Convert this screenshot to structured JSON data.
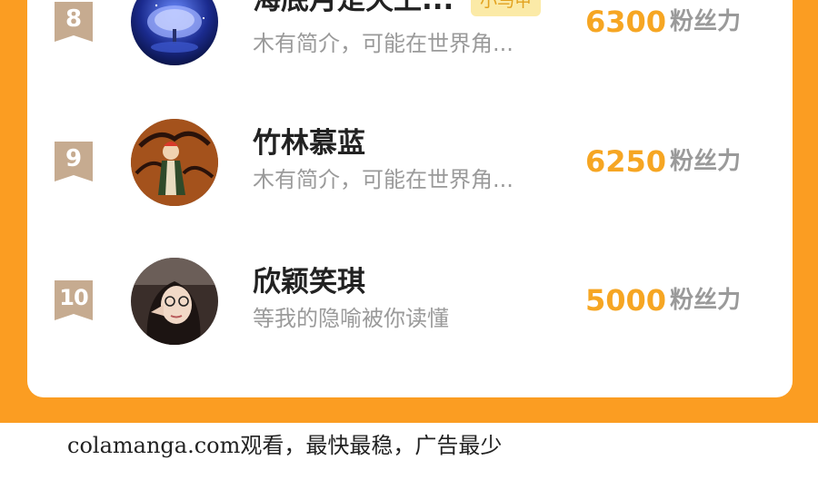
{
  "ranking": [
    {
      "rank": "8",
      "name": "海底月是天上...",
      "tag": "小马甲",
      "description": "木有简介，可能在世界角...",
      "fans": "6300",
      "fans_label": "粉丝力",
      "avatar": "tree-night-avatar"
    },
    {
      "rank": "9",
      "name": "竹林慕蓝",
      "tag": "",
      "description": "木有简介，可能在世界角...",
      "fans": "6250",
      "fans_label": "粉丝力",
      "avatar": "anime-character-avatar"
    },
    {
      "rank": "10",
      "name": "欣颖笑琪",
      "tag": "",
      "description": "等我的隐喻被你读懂",
      "fans": "5000",
      "fans_label": "粉丝力",
      "avatar": "girl-photo-avatar"
    }
  ],
  "watermark": "colamanga.com观看，最快最稳，广告最少",
  "colors": {
    "background": "#fb9d22",
    "fans_number": "#f6a623",
    "rank_badge": "#c6ab90",
    "tag_background": "#fbeaa7"
  }
}
